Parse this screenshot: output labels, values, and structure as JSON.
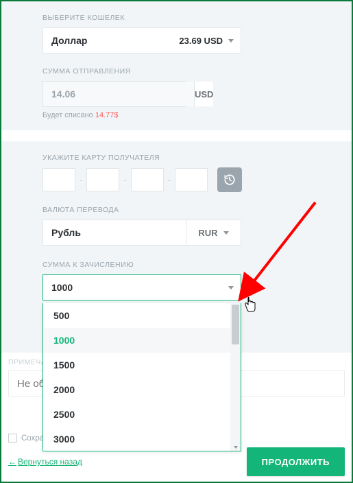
{
  "wallet": {
    "label": "ВЫБЕРИТЕ КОШЕЛЕК",
    "name": "Доллар",
    "balance": "23.69 USD"
  },
  "send": {
    "label": "СУММА ОТПРАВЛЕНИЯ",
    "value": "14.06",
    "currency": "USD",
    "hint_prefix": "Будет списано ",
    "hint_value": "14.77$"
  },
  "card": {
    "label": "УКАЖИТЕ КАРТУ ПОЛУЧАТЕЛЯ"
  },
  "currency": {
    "label": "ВАЛЮТА ПЕРЕВОДА",
    "name": "Рубль",
    "code": "RUR"
  },
  "credit": {
    "label": "СУММА К ЗАЧИСЛЕНИЮ",
    "value": "1000",
    "options": [
      "500",
      "1000",
      "1500",
      "2000",
      "2500",
      "3000"
    ],
    "selected_index": 1
  },
  "note": {
    "label": "ПРИМЕЧАН",
    "placeholder": "Не об"
  },
  "save": {
    "label": "Сохра"
  },
  "footer": {
    "back": "Вернуться назад",
    "continue": "ПРОДОЛЖИТЬ"
  }
}
